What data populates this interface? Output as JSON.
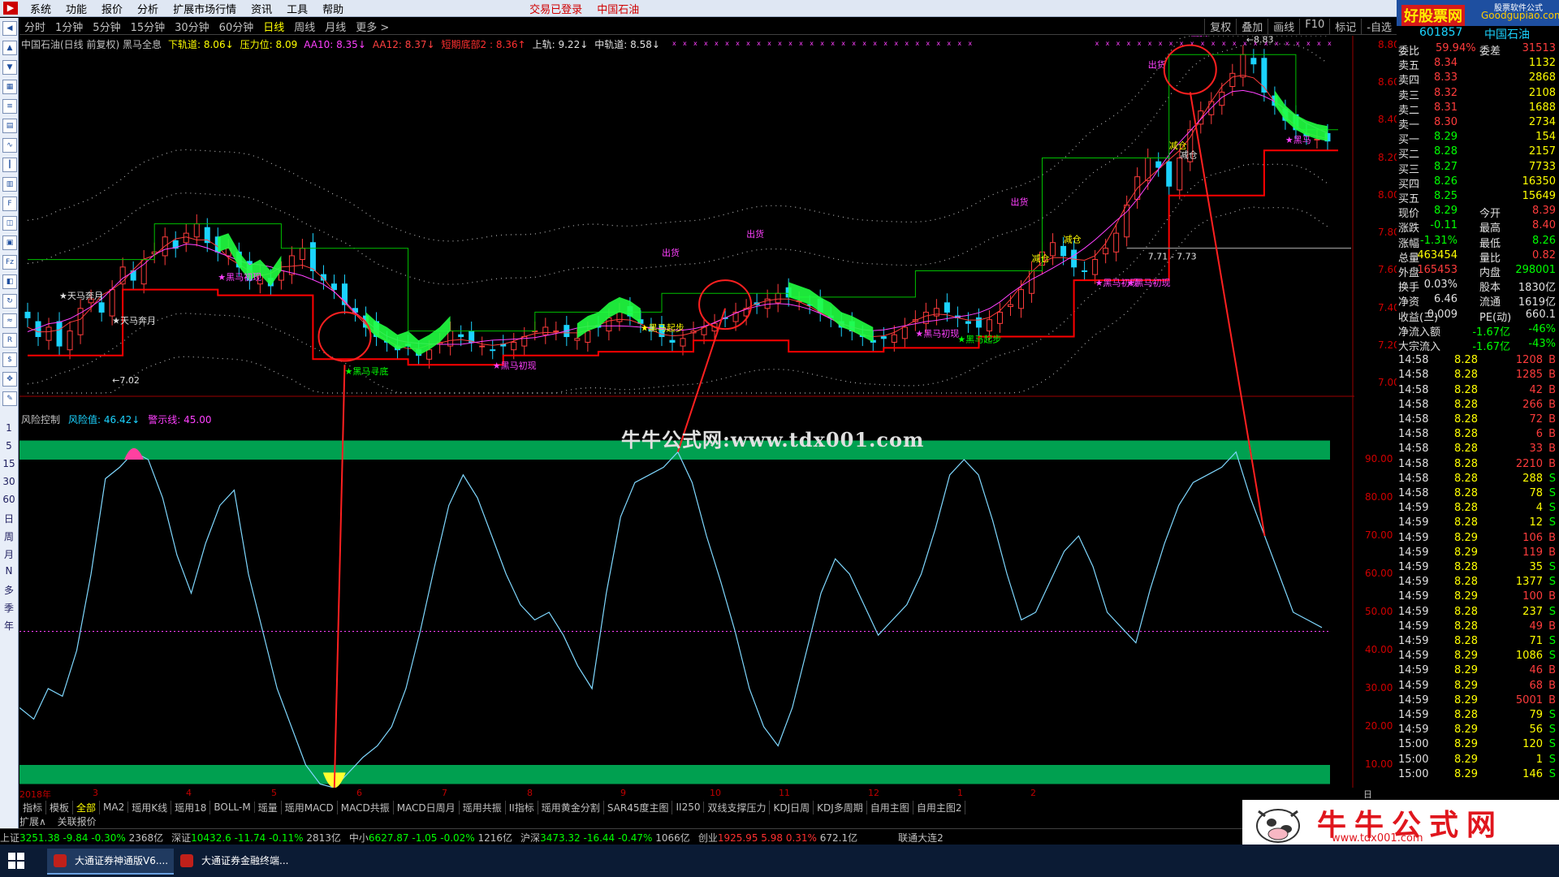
{
  "menubar": {
    "items": [
      "系统",
      "功能",
      "报价",
      "分析",
      "扩展市场行情",
      "资讯",
      "工具",
      "帮助"
    ],
    "status": [
      "交易已登录",
      "中国石油"
    ]
  },
  "brand": {
    "name": "好股票网",
    "domain": "Goodgupiao.com",
    "note": "股票软件公式"
  },
  "periods": [
    "分时",
    "1分钟",
    "5分钟",
    "15分钟",
    "30分钟",
    "60分钟",
    "日线",
    "周线",
    "月线",
    "更多 >"
  ],
  "toolbar_right": [
    "复权",
    "叠加",
    "画线",
    "F10",
    "标记",
    "-自选"
  ],
  "legend_main": [
    {
      "text": "中国石油(日线 前复权) 黑马全息",
      "color": "#c0c0c0"
    },
    {
      "text": "下轨道: 8.06↓",
      "color": "#ffff00"
    },
    {
      "text": "压力位: 8.09",
      "color": "#ffff00"
    },
    {
      "text": "AA10: 8.35↓",
      "color": "#ff40ff"
    },
    {
      "text": "AA12: 8.37↓",
      "color": "#ff4040"
    },
    {
      "text": "短期底部2 : 8.36↑",
      "color": "#ff3030"
    },
    {
      "text": "上轨: 9.22↓",
      "color": "#e0e0e0"
    },
    {
      "text": "中轨道: 8.58↓",
      "color": "#e0e0e0"
    }
  ],
  "legend_ind": [
    {
      "text": "风险控制",
      "color": "#c0c0c0"
    },
    {
      "text": "风险值: 46.42↓",
      "color": "#1bd3ff"
    },
    {
      "text": "警示线: 45.00",
      "color": "#ff40ff"
    }
  ],
  "watermark": "牛牛公式网:www.tdx001.com",
  "left_periods": [
    "1",
    "5",
    "15",
    "30",
    "60",
    "日",
    "周",
    "月",
    "N",
    "多",
    "季",
    "年"
  ],
  "price_axis": [
    "8.80",
    "8.60",
    "8.40",
    "8.20",
    "8.00",
    "7.80",
    "7.60",
    "7.40",
    "7.20",
    "7.00"
  ],
  "ind_axis": [
    "90.00",
    "80.00",
    "70.00",
    "60.00",
    "50.00",
    "40.00",
    "30.00",
    "20.00",
    "10.00"
  ],
  "date_axis": [
    "2018年",
    "3",
    "4",
    "5",
    "6",
    "7",
    "8",
    "9",
    "10",
    "11",
    "12",
    "1",
    "2"
  ],
  "axis_label_bottom": "日线",
  "annotations": {
    "low_label": "7.02",
    "high_label": "8.83",
    "range_label": "7.71 - 7.73",
    "signals": [
      "天马奔月",
      "天马奔月",
      "黑马初现",
      "黑马寻底",
      "黑马初现",
      "黑马起步",
      "出货",
      "出货",
      "黑马初现",
      "黑马起步",
      "出货",
      "减仓",
      "减仓",
      "黑马初现",
      "黑马初现",
      "出货",
      "出货",
      "减仓",
      "减仓",
      "黑马"
    ]
  },
  "bottom_tabs": [
    "指标",
    "模板",
    "全部",
    "MA2",
    "瑶用K线",
    "瑶用18",
    "BOLL-M",
    "瑶量",
    "瑶用MACD",
    "MACD共振",
    "MACD日周月",
    "瑶用共振",
    "II指标",
    "瑶用黄金分割",
    "SAR45度主图",
    "II250",
    "双线支撑压力",
    "KDJ日周",
    "KDJ多周期",
    "自用主图",
    "自用主图2"
  ],
  "sub_tabs": [
    "扩展∧",
    "关联报价"
  ],
  "index_bar": [
    {
      "name": "上证",
      "val": "3251.38",
      "chg": "-9.84",
      "pct": "-0.30%",
      "amt": "2368亿"
    },
    {
      "name": "深证",
      "val": "10432.6",
      "chg": "-11.74",
      "pct": "-0.11%",
      "amt": "2813亿"
    },
    {
      "name": "中小",
      "val": "6627.87",
      "chg": "-1.05",
      "pct": "-0.02%",
      "amt": "1216亿"
    },
    {
      "name": "沪深",
      "val": "3473.32",
      "chg": "-16.44",
      "pct": "-0.47%",
      "amt": "1066亿"
    },
    {
      "name": "创业",
      "val": "1925.95",
      "chg": "5.98",
      "pct": "0.31%",
      "amt": "672.1亿"
    }
  ],
  "index_tail": "联通大连2",
  "taskbar": [
    "大通证券神通版V6....",
    "大通证券金融终端..."
  ],
  "side": {
    "code": "601857",
    "name": "中国石油",
    "weibi": {
      "label": "委比",
      "val": "59.94%",
      "label2": "委差",
      "val2": "31513"
    },
    "asks": [
      {
        "label": "卖五",
        "price": "8.34",
        "vol": "1132"
      },
      {
        "label": "卖四",
        "price": "8.33",
        "vol": "2868"
      },
      {
        "label": "卖三",
        "price": "8.32",
        "vol": "2108"
      },
      {
        "label": "卖二",
        "price": "8.31",
        "vol": "1688"
      },
      {
        "label": "卖一",
        "price": "8.30",
        "vol": "2734"
      }
    ],
    "bids": [
      {
        "label": "买一",
        "price": "8.29",
        "vol": "154"
      },
      {
        "label": "买二",
        "price": "8.28",
        "vol": "2157"
      },
      {
        "label": "买三",
        "price": "8.27",
        "vol": "7733"
      },
      {
        "label": "买四",
        "price": "8.26",
        "vol": "16350"
      },
      {
        "label": "买五",
        "price": "8.25",
        "vol": "15649"
      }
    ],
    "quote": [
      [
        "现价",
        "8.29",
        "今开",
        "8.39"
      ],
      [
        "涨跌",
        "-0.11",
        "最高",
        "8.40"
      ],
      [
        "涨幅",
        "-1.31%",
        "最低",
        "8.26"
      ],
      [
        "总量",
        "463454",
        "量比",
        "0.82"
      ],
      [
        "外盘",
        "165453",
        "内盘",
        "298001"
      ]
    ],
    "fund": [
      [
        "换手",
        "0.03%",
        "股本",
        "1830亿"
      ],
      [
        "净资",
        "6.46",
        "流通",
        "1619亿"
      ],
      [
        "收益(三)",
        "0.009",
        "PE(动)",
        "660.1"
      ]
    ],
    "flow": [
      [
        "净流入额",
        "-1.67亿",
        "-46%"
      ],
      [
        "大宗流入",
        "-1.67亿",
        "-43%"
      ]
    ],
    "ticks": [
      [
        "14:58",
        "8.28",
        "1208",
        "B"
      ],
      [
        "14:58",
        "8.28",
        "1285",
        "B"
      ],
      [
        "14:58",
        "8.28",
        "42",
        "B"
      ],
      [
        "14:58",
        "8.28",
        "266",
        "B"
      ],
      [
        "14:58",
        "8.28",
        "72",
        "B"
      ],
      [
        "14:58",
        "8.28",
        "6",
        "B"
      ],
      [
        "14:58",
        "8.28",
        "33",
        "B"
      ],
      [
        "14:58",
        "8.28",
        "2210",
        "B"
      ],
      [
        "14:58",
        "8.28",
        "288",
        "S"
      ],
      [
        "14:58",
        "8.28",
        "78",
        "S"
      ],
      [
        "14:59",
        "8.28",
        "4",
        "S"
      ],
      [
        "14:59",
        "8.28",
        "12",
        "S"
      ],
      [
        "14:59",
        "8.29",
        "106",
        "B"
      ],
      [
        "14:59",
        "8.29",
        "119",
        "B"
      ],
      [
        "14:59",
        "8.28",
        "35",
        "S"
      ],
      [
        "14:59",
        "8.28",
        "1377",
        "S"
      ],
      [
        "14:59",
        "8.29",
        "100",
        "B"
      ],
      [
        "14:59",
        "8.28",
        "237",
        "S"
      ],
      [
        "14:59",
        "8.28",
        "49",
        "B"
      ],
      [
        "14:59",
        "8.28",
        "71",
        "S"
      ],
      [
        "14:59",
        "8.29",
        "1086",
        "S"
      ],
      [
        "14:59",
        "8.29",
        "46",
        "B"
      ],
      [
        "14:59",
        "8.29",
        "68",
        "B"
      ],
      [
        "14:59",
        "8.29",
        "5001",
        "B"
      ],
      [
        "14:59",
        "8.28",
        "79",
        "S"
      ],
      [
        "14:59",
        "8.29",
        "56",
        "S"
      ],
      [
        "15:00",
        "8.29",
        "120",
        "S"
      ],
      [
        "15:00",
        "8.29",
        "1",
        "S"
      ],
      [
        "15:00",
        "8.29",
        "146",
        "S"
      ]
    ]
  },
  "corner_logo": {
    "title": "牛牛公式网",
    "url": "www.tdx001.com"
  },
  "colors": {
    "up": "#ff3c3c",
    "down": "#1bd3ff",
    "band": "#00a050",
    "risk_line": "#7fd8ff",
    "support": "#ff0000"
  },
  "chart_data": [
    {
      "type": "candlestick",
      "title": "中国石油(日线 前复权) 黑马全息",
      "ylim": [
        6.95,
        8.85
      ],
      "x_ticks": [
        "2018年",
        "3",
        "4",
        "5",
        "6",
        "7",
        "8",
        "9",
        "10",
        "11",
        "12",
        "1",
        "2"
      ],
      "note_high": 8.83,
      "note_low": 7.02,
      "close_series": [
        7.35,
        7.25,
        7.3,
        7.2,
        7.28,
        7.4,
        7.45,
        7.38,
        7.5,
        7.62,
        7.55,
        7.66,
        7.7,
        7.78,
        7.72,
        7.8,
        7.85,
        7.75,
        7.7,
        7.72,
        7.62,
        7.55,
        7.58,
        7.52,
        7.6,
        7.68,
        7.72,
        7.6,
        7.55,
        7.5,
        7.42,
        7.38,
        7.3,
        7.25,
        7.22,
        7.18,
        7.2,
        7.15,
        7.18,
        7.22,
        7.28,
        7.25,
        7.22,
        7.2,
        7.18,
        7.2,
        7.22,
        7.25,
        7.28,
        7.3,
        7.28,
        7.25,
        7.24,
        7.28,
        7.3,
        7.35,
        7.38,
        7.36,
        7.32,
        7.28,
        7.25,
        7.22,
        7.24,
        7.28,
        7.3,
        7.32,
        7.35,
        7.38,
        7.4,
        7.42,
        7.45,
        7.48,
        7.46,
        7.44,
        7.42,
        7.38,
        7.35,
        7.3,
        7.28,
        7.25,
        7.22,
        7.24,
        7.26,
        7.3,
        7.34,
        7.38,
        7.4,
        7.38,
        7.35,
        7.32,
        7.3,
        7.34,
        7.38,
        7.42,
        7.5,
        7.6,
        7.7,
        7.75,
        7.68,
        7.62,
        7.6,
        7.66,
        7.72,
        7.8,
        7.95,
        8.1,
        8.2,
        8.15,
        8.05,
        8.2,
        8.35,
        8.45,
        8.5,
        8.55,
        8.65,
        8.75,
        8.7,
        8.55,
        8.48,
        8.4,
        8.35,
        8.32,
        8.3,
        8.29
      ]
    },
    {
      "type": "line",
      "title": "风险控制",
      "ylim": [
        0,
        100
      ],
      "x_ticks": [
        "2018年",
        "3",
        "4",
        "5",
        "6",
        "7",
        "8",
        "9",
        "10",
        "11",
        "12",
        "1",
        "2"
      ],
      "series": [
        {
          "name": "风险值",
          "values": [
            25,
            22,
            30,
            28,
            40,
            60,
            85,
            88,
            92,
            90,
            80,
            65,
            55,
            68,
            78,
            82,
            60,
            45,
            30,
            20,
            10,
            5,
            4,
            8,
            12,
            15,
            20,
            30,
            45,
            62,
            78,
            86,
            80,
            70,
            60,
            52,
            48,
            50,
            44,
            36,
            30,
            55,
            75,
            84,
            86,
            88,
            92,
            84,
            70,
            58,
            45,
            30,
            20,
            15,
            25,
            40,
            55,
            64,
            60,
            52,
            44,
            48,
            52,
            60,
            72,
            86,
            90,
            86,
            74,
            60,
            48,
            50,
            58,
            66,
            70,
            62,
            50,
            46,
            42,
            56,
            68,
            78,
            84,
            86,
            88,
            92,
            80,
            70,
            60,
            50,
            48,
            46
          ]
        }
      ],
      "warning_line": 45.0,
      "bands": [
        [
          90,
          95
        ],
        [
          5,
          10
        ]
      ]
    }
  ]
}
